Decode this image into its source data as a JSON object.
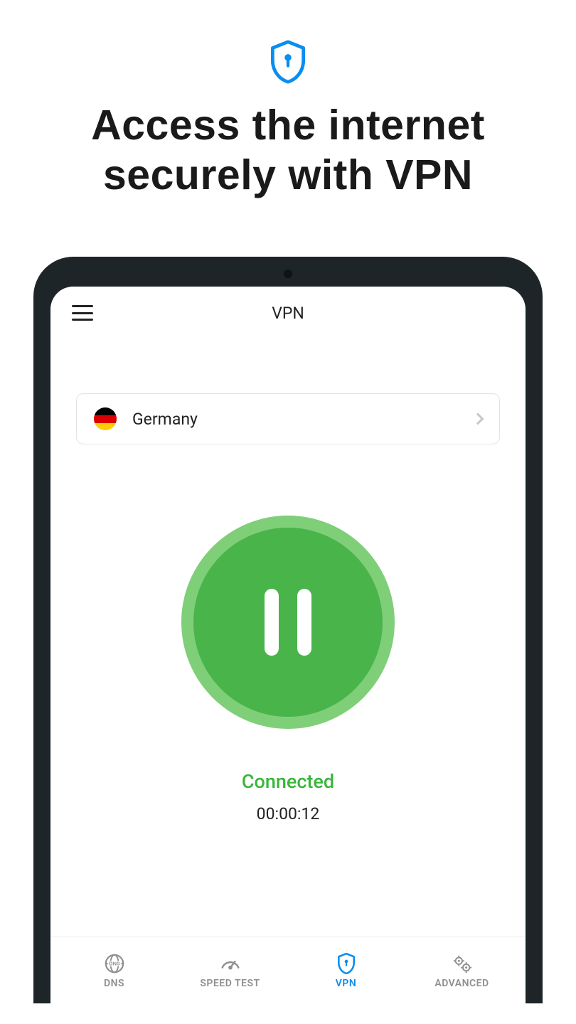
{
  "promo": {
    "headline_l1": "Access the internet",
    "headline_l2": "securely with VPN"
  },
  "topbar": {
    "title": "VPN"
  },
  "country": {
    "name": "Germany",
    "flag": "germany"
  },
  "connection": {
    "status": "Connected",
    "timer": "00:00:12",
    "button_state": "pause"
  },
  "nav": {
    "items": [
      {
        "id": "dns",
        "label": "DNS",
        "icon": "dns-icon",
        "active": false
      },
      {
        "id": "speed",
        "label": "SPEED TEST",
        "icon": "gauge-icon",
        "active": false
      },
      {
        "id": "vpn",
        "label": "VPN",
        "icon": "shield-icon",
        "active": true
      },
      {
        "id": "advanced",
        "label": "ADVANCED",
        "icon": "gears-icon",
        "active": false
      }
    ]
  },
  "colors": {
    "accent_blue": "#0a8df0",
    "accent_green": "#49b44a",
    "green_ring": "#7fcf79"
  }
}
